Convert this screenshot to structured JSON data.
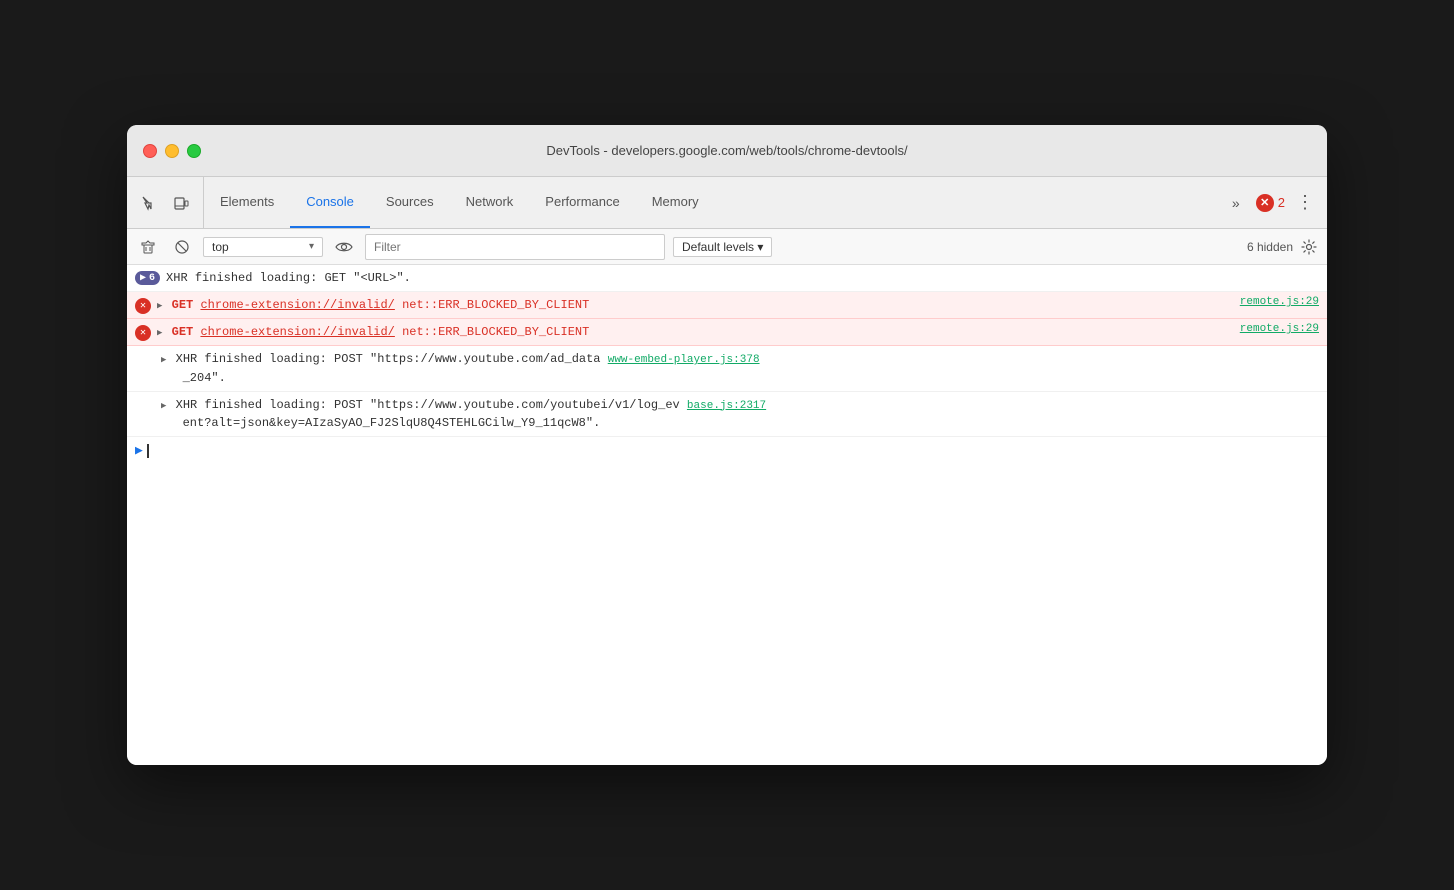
{
  "window": {
    "title": "DevTools - developers.google.com/web/tools/chrome-devtools/"
  },
  "tabs": [
    {
      "id": "elements",
      "label": "Elements",
      "active": false
    },
    {
      "id": "console",
      "label": "Console",
      "active": true
    },
    {
      "id": "sources",
      "label": "Sources",
      "active": false
    },
    {
      "id": "network",
      "label": "Network",
      "active": false
    },
    {
      "id": "performance",
      "label": "Performance",
      "active": false
    },
    {
      "id": "memory",
      "label": "Memory",
      "active": false
    }
  ],
  "toolbar": {
    "more_label": "»",
    "error_count": "2",
    "more_icon": "⋮"
  },
  "console_toolbar": {
    "context_label": "top",
    "filter_placeholder": "Filter",
    "levels_label": "Default levels ▾",
    "hidden_count": "6 hidden"
  },
  "log_entries": [
    {
      "type": "xhr",
      "badge": "▶ 6",
      "text": "XHR finished loading: GET \"<URL>\".",
      "source": null
    },
    {
      "type": "error",
      "text_parts": [
        "▶ GET ",
        "chrome-extension://invalid/",
        " net::ERR_BLOCKED_BY_CLIENT"
      ],
      "source": "remote.js:29"
    },
    {
      "type": "error",
      "text_parts": [
        "▶ GET ",
        "chrome-extension://invalid/",
        " net::ERR_BLOCKED_BY_CLIENT"
      ],
      "source": "remote.js:29"
    },
    {
      "type": "xhr2",
      "text": "▶ XHR finished loading: POST \"",
      "link": "https://www.youtube.com/ad_data",
      "text2": " www-embed-player.js:378",
      "text3": "_204\".",
      "source": "www-embed-player.js:378"
    },
    {
      "type": "xhr3",
      "text": "▶ XHR finished loading: POST \"",
      "link": "https://www.youtube.com/youtubei/v1/log_ev",
      "text2": "ent?alt=json&key=AIzaSyAO_FJ2SlqU8Q4STEHLGCilw_Y9_11qcW8\".",
      "source": "base.js:2317"
    }
  ]
}
